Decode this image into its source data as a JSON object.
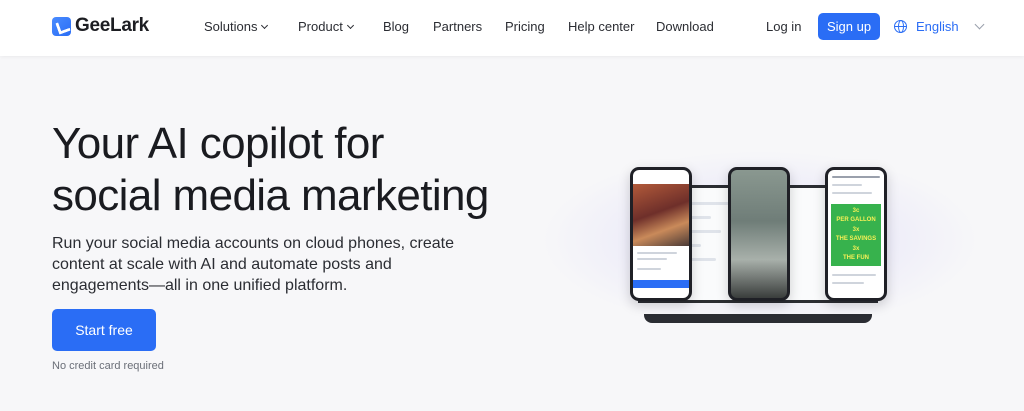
{
  "brand": {
    "name": "GeeLark"
  },
  "nav": {
    "items": [
      {
        "label": "Solutions",
        "dropdown": true
      },
      {
        "label": "Product",
        "dropdown": true
      },
      {
        "label": "Blog"
      },
      {
        "label": "Partners"
      },
      {
        "label": "Pricing"
      },
      {
        "label": "Help center"
      },
      {
        "label": "Download"
      }
    ],
    "login": "Log in",
    "signup": "Sign up",
    "language": "English"
  },
  "hero": {
    "title_line1": "Your AI copilot for",
    "title_line2": "social media marketing",
    "subtitle": "Run your social media accounts on cloud phones, create content at scale with AI and automate posts and engagements—all in one unified platform.",
    "cta": "Start free",
    "note": "No credit card required"
  },
  "promo": {
    "lines": [
      "3c",
      "PER GALLON",
      "3x",
      "THE SAVINGS",
      "3x",
      "THE FUN"
    ]
  },
  "colors": {
    "accent": "#2a6df5",
    "text": "#1c1d22",
    "background": "#f7f7f9"
  }
}
